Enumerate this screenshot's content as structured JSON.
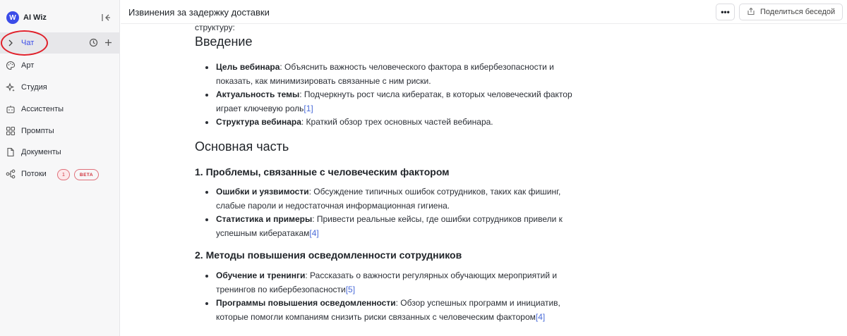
{
  "app": {
    "name": "AI Wiz",
    "logo_letter": "W"
  },
  "sidebar": {
    "items": [
      {
        "label": "Чат",
        "icon": "chevron-right-icon",
        "active": true
      },
      {
        "label": "Арт",
        "icon": "palette-icon"
      },
      {
        "label": "Студия",
        "icon": "sparkle-icon"
      },
      {
        "label": "Ассистенты",
        "icon": "bot-icon"
      },
      {
        "label": "Промпты",
        "icon": "grid-icon"
      },
      {
        "label": "Документы",
        "icon": "document-icon"
      },
      {
        "label": "Потоки",
        "icon": "flow-icon",
        "count": "1",
        "badge": "BETA"
      }
    ]
  },
  "header": {
    "title": "Извинения за задержку доставки",
    "more_label": "•••",
    "share_label": "Поделиться беседой"
  },
  "content": {
    "pre": "структуру:",
    "h_intro": "Введение",
    "intro": [
      {
        "bold": "Цель вебинара",
        "text_1": ": Объяснить важность человеческого фактора в кибербезопасности и",
        "text_2": "показать, как минимизировать связанные с ним риски.",
        "ref": ""
      },
      {
        "bold": "Актуальность темы",
        "text_1": ": Подчеркнуть рост числа кибератак, в которых человеческий фактор",
        "text_2": "играет ключевую роль",
        "ref": "[1]"
      },
      {
        "bold": "Структура вебинара",
        "text_1": ": Краткий обзор трех основных частей вебинара.",
        "text_2": "",
        "ref": ""
      }
    ],
    "h_main": "Основная часть",
    "h_s1": "1. Проблемы, связанные с человеческим фактором",
    "s1": [
      {
        "bold": "Ошибки и уязвимости",
        "text_1": ": Обсуждение типичных ошибок сотрудников, таких как фишинг,",
        "text_2": "слабые пароли и недостаточная информационная гигиена.",
        "ref": ""
      },
      {
        "bold": "Статистика и примеры",
        "text_1": ": Привести реальные кейсы, где ошибки сотрудников привели к",
        "text_2": "успешным кибератакам",
        "ref": "[4]"
      }
    ],
    "h_s2": "2. Методы повышения осведомленности сотрудников",
    "s2": [
      {
        "bold": "Обучение и тренинги",
        "text_1": ": Рассказать о важности регулярных обучающих мероприятий и",
        "text_2": "тренингов по кибербезопасности",
        "ref": "[5]"
      },
      {
        "bold": "Программы повышения осведомленности",
        "text_1": ": Обзор успешных программ и инициатив,",
        "text_2": "которые помогли компаниям снизить риски связанных с человеческим фактором",
        "ref": "[4]"
      }
    ]
  },
  "colors": {
    "accent": "#3b4ce8",
    "annotation": "#e0202a",
    "link": "#4a6bd8"
  }
}
